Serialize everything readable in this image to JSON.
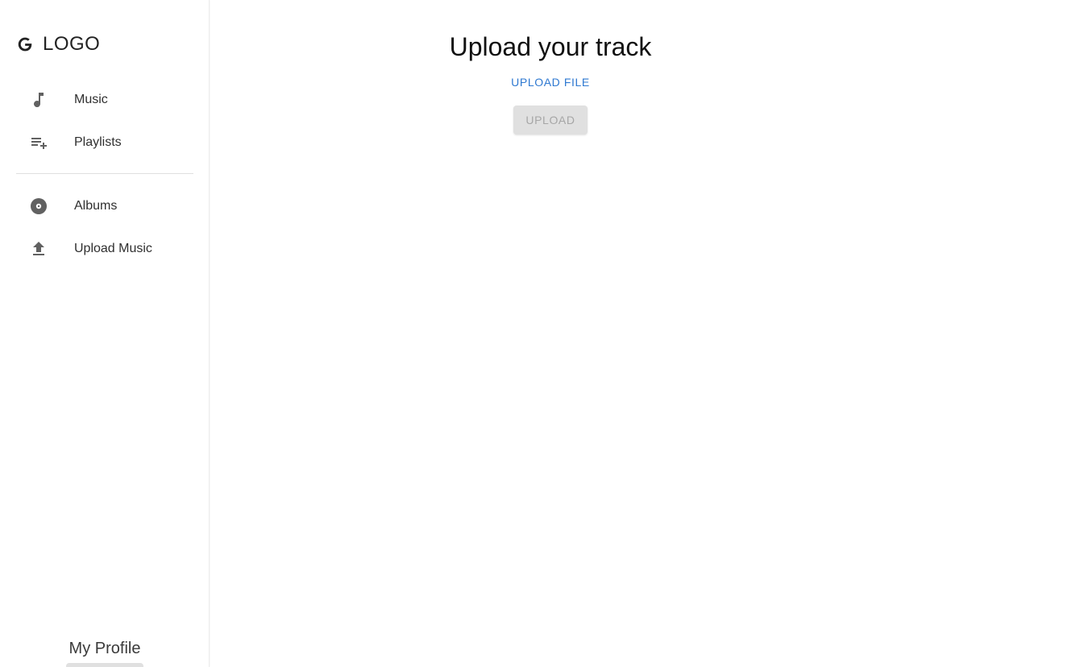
{
  "sidebar": {
    "logo": {
      "icon": "g-logo-icon",
      "text": "LOGO"
    },
    "primary_items": [
      {
        "label": "Music",
        "icon": "music-note-icon"
      },
      {
        "label": "Playlists",
        "icon": "playlist-add-icon"
      }
    ],
    "secondary_items": [
      {
        "label": "Albums",
        "icon": "album-icon"
      },
      {
        "label": "Upload Music",
        "icon": "upload-icon"
      }
    ],
    "profile": {
      "label": "My Profile"
    }
  },
  "main": {
    "title": "Upload your track",
    "upload_file_label": "UPLOAD FILE",
    "upload_button_label": "UPLOAD",
    "upload_button_disabled": true
  },
  "colors": {
    "accent": "#2f79d1",
    "icon": "#616161",
    "disabled_bg": "#e0e0e0",
    "disabled_text": "#a6a6a6"
  }
}
